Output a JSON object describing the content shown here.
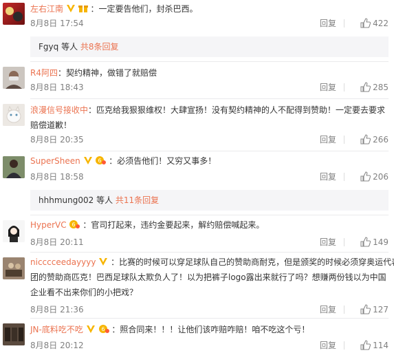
{
  "colors": {
    "username": "#eb7350",
    "link": "#eb7350",
    "meta": "#808080",
    "text": "#333333",
    "reply_bar_bg": "#f5f5f7"
  },
  "comments": [
    {
      "user": "左右江南",
      "badges": [
        "vip-v-icon",
        "gift-icon"
      ],
      "text": "：一定要告他们，封杀巴西。",
      "date": "8月8日 17:54",
      "reply": "回复",
      "likes": "422"
    },
    {
      "user": "R4阿四",
      "badges": [],
      "text": "：契约精神，做错了就赔偿",
      "date": "8月8日 18:43",
      "reply": "回复",
      "likes": "285"
    },
    {
      "user": "浪漫信号接收中",
      "badges": [],
      "text_line1": "：匹克给我狠狠维权！大肆宣扬！没有契约精神的人不配得到赞助！一定要去要求",
      "text_line2": "赔偿道歉！",
      "date": "8月8日 20:35",
      "reply": "回复",
      "likes": "266"
    },
    {
      "user": "SuperSheen",
      "badges": [
        "vip-v-icon",
        "fan-badge-icon"
      ],
      "text": "：必须告他们！又穷又事多！",
      "date": "8月8日 18:58",
      "reply": "回复",
      "likes": "206"
    },
    {
      "user": "HyperVC",
      "badges": [
        "fan-badge-icon"
      ],
      "text": "：官司打起来，违约金要起来，解约赔偿喊起来。",
      "date": "8月8日 20:11",
      "reply": "回复",
      "likes": "149"
    },
    {
      "user": "nicccceedayyyy",
      "badges": [
        "vip-v-icon"
      ],
      "text_line1": "：比赛的时候可以穿足球队自己的赞助商耐克，但是颁奖的时候必须穿奥运代表",
      "text_line2": "团的赞助商匹克！巴西足球队太欺负人了！以为把裤子logo露出来就行了吗？想赚两份钱以为中国",
      "text_line3": "企业看不出来你们的小把戏？",
      "date": "8月8日 21:36",
      "reply": "回复",
      "likes": "127"
    },
    {
      "user": "JN-底料吃不吃",
      "badges": [
        "vip-v-icon",
        "fan-badge-icon"
      ],
      "text": "：照合同来！！！让他们该咋赔咋赔！咱不吃这个亏！",
      "date": "8月8日 20:12",
      "reply": "回复",
      "likes": "114"
    }
  ],
  "reply_bars": [
    {
      "who": "Fgyq",
      "mid": " 等人 ",
      "more": "共8条回复"
    },
    {
      "who": "hhhmung002",
      "mid": " 等人 ",
      "more": "共11条回复"
    }
  ]
}
